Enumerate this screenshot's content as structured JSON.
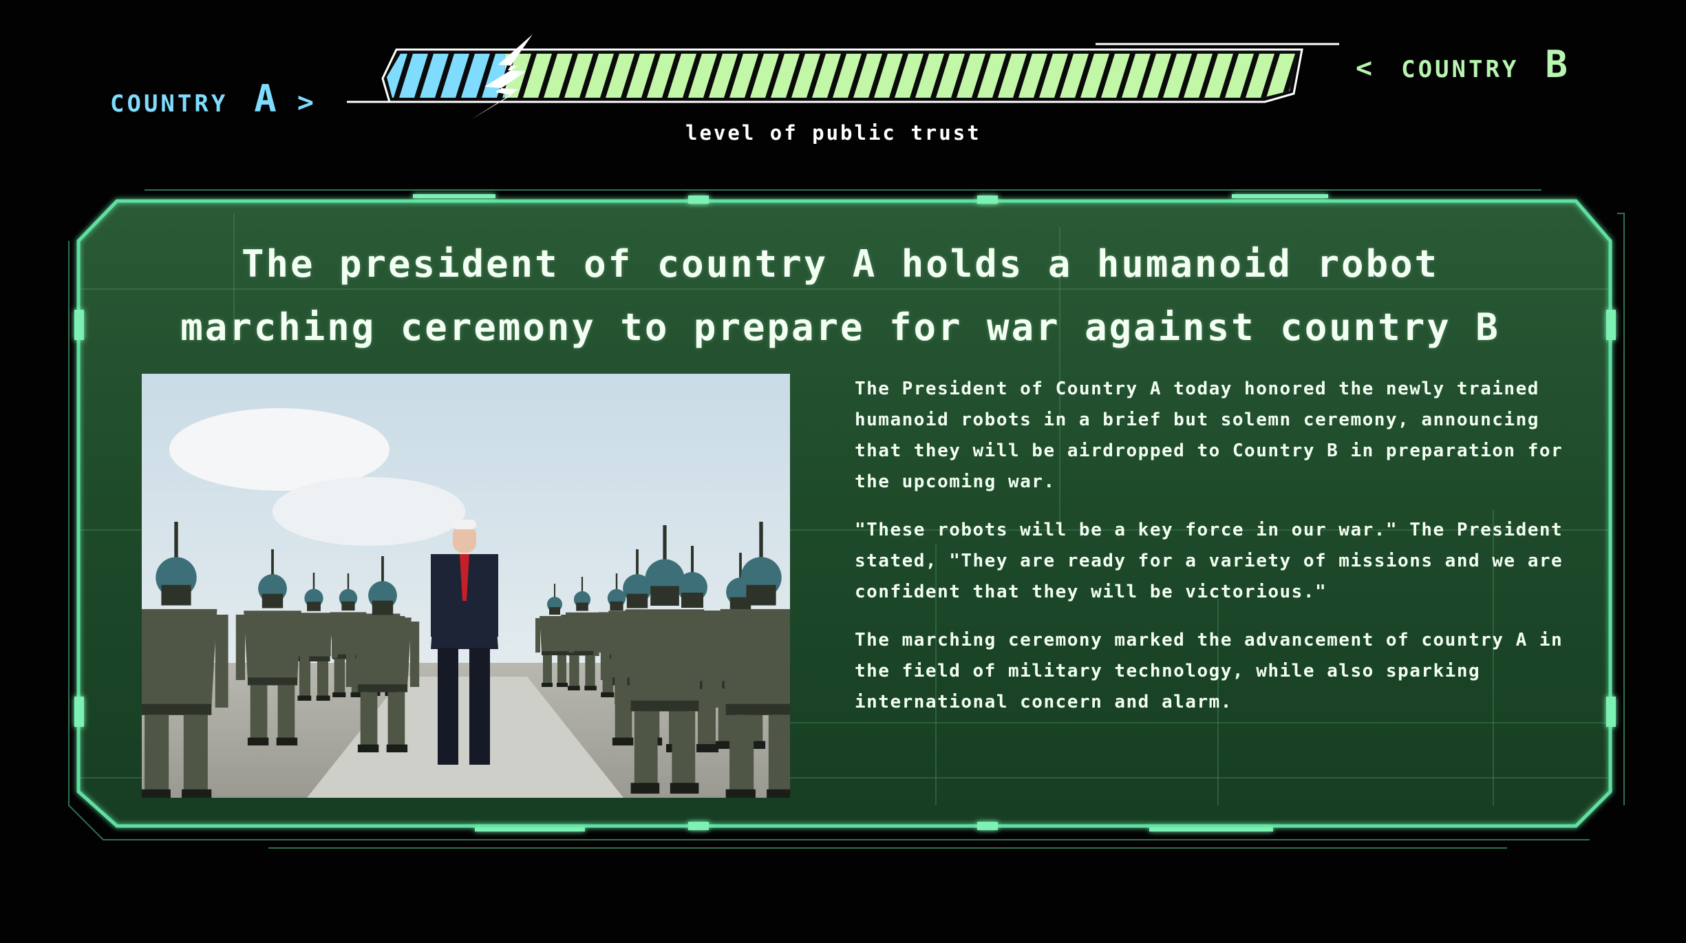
{
  "hud": {
    "country_a": {
      "label": "COUNTRY",
      "letter": "A",
      "arrow": ">"
    },
    "country_b": {
      "label": "COUNTRY",
      "letter": "B",
      "arrow": "<"
    },
    "trust_label": "level of public trust",
    "trust_share_country_a": 0.13,
    "colors": {
      "country_a": "#7fdcff",
      "country_b": "#b8f5b0",
      "panel": "#1f4a2c",
      "frame": "#5fe0a0"
    }
  },
  "news": {
    "headline_line1": "The president of country A holds a humanoid robot",
    "headline_line2": "marching ceremony to prepare for war against country B",
    "paragraphs": [
      "The President of Country A today honored the newly trained humanoid robots in a brief but solemn ceremony, announcing that they will be airdropped to Country B in preparation for the upcoming war.",
      "\"These robots will be a key force in our war.\" The President stated, \"They are ready for a variety of missions and we are confident that they will be victorious.\"",
      "The marching ceremony marked the advancement of country A in the field of military technology, while also sparking international concern and alarm."
    ],
    "image_icon": "news-photo-robot-parade"
  }
}
